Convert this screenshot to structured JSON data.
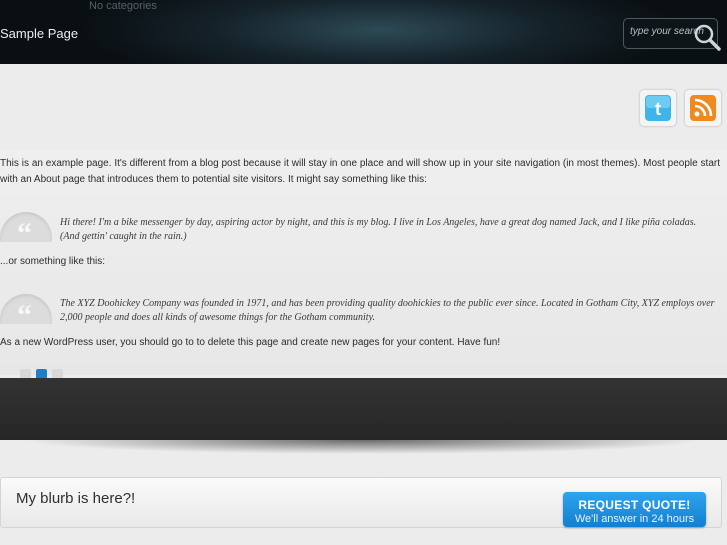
{
  "header": {
    "categories_text": "No categories",
    "nav": [
      "Sample Page"
    ],
    "search": {
      "placeholder": "type your search"
    }
  },
  "social": {
    "icons": [
      "twitter-icon",
      "rss-icon"
    ]
  },
  "content": {
    "intro": "This is an example page. It's different from a blog post because it will stay in one place and will show up in your site navigation (in most themes). Most people start with an About page that introduces them to potential site visitors. It might say something like this:",
    "quote1": "Hi there! I'm a bike messenger by day, aspiring actor by night, and this is my blog. I live in Los Angeles, have a great dog named Jack, and I like piña coladas. (And gettin' caught in the rain.)",
    "middle": "...or something like this:",
    "quote2": "The XYZ Doohickey Company was founded in 1971, and has been providing quality doohickies to the public ever since. Located in Gotham City, XYZ employs over 2,000 people and does all kinds of awesome things for the Gotham community.",
    "outro": "As a new WordPress user, you should go to to delete this page and create new pages for your content. Have fun!"
  },
  "slider": {
    "total": 3,
    "active": 2
  },
  "blurb": {
    "text": "My blurb is here?!",
    "button_line1": "REQUEST QUOTE!",
    "button_line2": "We'll answer in 24 hours"
  },
  "colors": {
    "accent": "#1f7fc4",
    "header_bg": "#0a0f12"
  }
}
